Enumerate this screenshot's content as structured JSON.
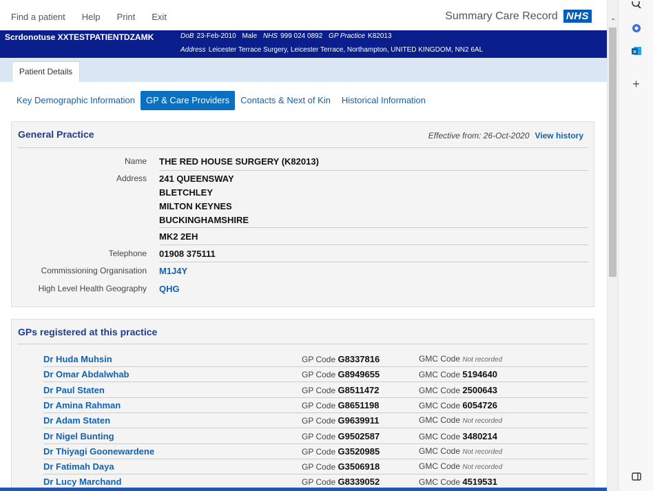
{
  "menu": [
    "Find a patient",
    "Help",
    "Print",
    "Exit"
  ],
  "brand": {
    "title": "Summary Care Record",
    "logo": "NHS"
  },
  "patient": {
    "name": "Scrdonotuse XXTESTPATIENTDZAMK",
    "dob_label": "DoB",
    "dob": "23-Feb-2010",
    "gender": "Male",
    "nhs_label": "NHS",
    "nhs": "999 024 0892",
    "gp_label": "GP Practice",
    "gp": "K82013",
    "address_label": "Address",
    "address": "Leicester Terrace Surgery, Leicester Terrace, Northampton, UNITED KINGDOM, NN2 6AL"
  },
  "tab": "Patient Details",
  "subnav": [
    "Key Demographic Information",
    "GP & Care Providers",
    "Contacts & Next of Kin",
    "Historical Information"
  ],
  "general_practice": {
    "title": "General Practice",
    "effective": "Effective from: 26-Oct-2020",
    "history": "View history",
    "name_label": "Name",
    "name": "THE RED HOUSE SURGERY (K82013)",
    "address_label": "Address",
    "address_lines": [
      "241 QUEENSWAY",
      "BLETCHLEY",
      "MILTON KEYNES",
      "BUCKINGHAMSHIRE"
    ],
    "postcode": "MK2 2EH",
    "telephone_label": "Telephone",
    "telephone": "01908 375111",
    "commissioning_label": "Commissioning Organisation",
    "commissioning": "M1J4Y",
    "geography_label": "High Level Health Geography",
    "geography": "QHG"
  },
  "gps": {
    "title": "GPs registered at this practice",
    "gp_code_label": "GP Code",
    "gmc_code_label": "GMC Code",
    "rows": [
      {
        "name": "Dr Huda Muhsin",
        "gp": "G8337816",
        "gmc": "",
        "gmc_note": "Not recorded"
      },
      {
        "name": "Dr Omar Abdalwhab",
        "gp": "G8949655",
        "gmc": "5194640",
        "gmc_note": ""
      },
      {
        "name": "Dr Paul Staten",
        "gp": "G8511472",
        "gmc": "2500643",
        "gmc_note": ""
      },
      {
        "name": "Dr Amina Rahman",
        "gp": "G8651198",
        "gmc": "6054726",
        "gmc_note": ""
      },
      {
        "name": "Dr Adam Staten",
        "gp": "G9639911",
        "gmc": "",
        "gmc_note": "Not recorded"
      },
      {
        "name": "Dr Nigel Bunting",
        "gp": "G9502587",
        "gmc": "3480214",
        "gmc_note": ""
      },
      {
        "name": "Dr Thiyagi Goonewardene",
        "gp": "G3520985",
        "gmc": "",
        "gmc_note": "Not recorded"
      },
      {
        "name": "Dr Fatimah Daya",
        "gp": "G3506918",
        "gmc": "",
        "gmc_note": "Not recorded"
      },
      {
        "name": "Dr Lucy Marchand",
        "gp": "G8339052",
        "gmc": "4519531",
        "gmc_note": ""
      }
    ]
  },
  "colors": {
    "nhs_blue": "#005EB8",
    "header_navy": "#0b1f8c",
    "link": "#0f63b2",
    "active_tab": "#0a70bf"
  },
  "side_icons": [
    "search-icon",
    "copilot-icon",
    "outlook-icon",
    "add-icon",
    "sidebar-toggle-icon"
  ]
}
